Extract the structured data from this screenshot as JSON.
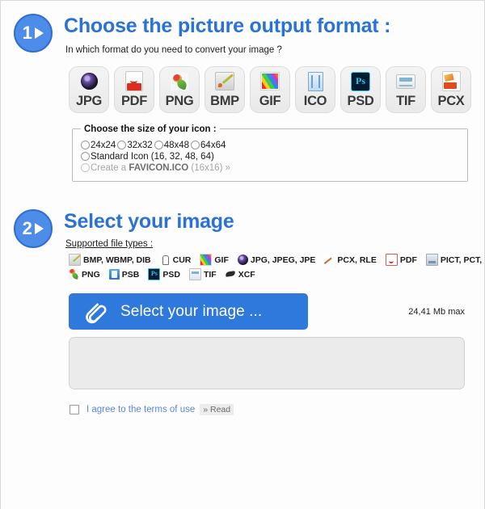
{
  "step1": {
    "badge_number": "1",
    "title": "Choose the picture output format :",
    "subtitle": "In which format do you need to convert your image ?",
    "formats": [
      {
        "label": "JPG",
        "icon": "jpg-camera-lens-icon"
      },
      {
        "label": "PDF",
        "icon": "pdf-document-icon"
      },
      {
        "label": "PNG",
        "icon": "png-image-icon"
      },
      {
        "label": "BMP",
        "icon": "bmp-paint-icon"
      },
      {
        "label": "GIF",
        "icon": "gif-rainbow-image-icon"
      },
      {
        "label": "ICO",
        "icon": "ico-icon"
      },
      {
        "label": "PSD",
        "icon": "psd-photoshop-icon"
      },
      {
        "label": "TIF",
        "icon": "tif-icon"
      },
      {
        "label": "PCX",
        "icon": "pcx-icon"
      }
    ],
    "size_fieldset": {
      "legend": "Choose the size of your icon :",
      "row1": [
        {
          "label": "24x24"
        },
        {
          "label": "32x32"
        },
        {
          "label": "48x48"
        },
        {
          "label": "64x64"
        }
      ],
      "row2_label": "Standard Icon (16, 32, 48, 64)",
      "row3_prefix": "Create a ",
      "row3_strong": "FAVICON.ICO",
      "row3_suffix": " (16x16) »"
    }
  },
  "step2": {
    "badge_number": "2",
    "title": "Select your image",
    "supported_label": "Supported file types :",
    "supported_line1": [
      {
        "label": "BMP, WBMP, DIB",
        "icon": "bmp-file-icon"
      },
      {
        "label": "CUR",
        "icon": "cur-cursor-icon"
      },
      {
        "label": "GIF",
        "icon": "gif-file-icon"
      },
      {
        "label": "JPG, JPEG, JPE",
        "icon": "jpg-file-icon"
      },
      {
        "label": "PCX, RLE",
        "icon": "pcx-file-icon"
      },
      {
        "label": "PDF",
        "icon": "pdf-file-icon"
      },
      {
        "label": "PICT, PCT, PIC",
        "icon": "pict-file-icon"
      }
    ],
    "supported_line2": [
      {
        "label": "PNG",
        "icon": "png-file-icon"
      },
      {
        "label": "PSB",
        "icon": "psb-file-icon"
      },
      {
        "label": "PSD",
        "icon": "psd-file-icon"
      },
      {
        "label": "TIF",
        "icon": "tif-file-icon"
      },
      {
        "label": "XCF",
        "icon": "xcf-file-icon"
      }
    ],
    "select_button_label": "Select your image ...",
    "select_button_icon": "paperclip-icon",
    "max_size": "24,41 Mb max"
  },
  "terms": {
    "agree_label": "I agree to the terms of use",
    "read_label": "» Read"
  },
  "colors": {
    "accent_blue": "#2a72d4",
    "badge_blue": "#4d8ce8",
    "button_blue": "#2f78dc",
    "link_blue": "#5b87d8",
    "page_bg": "#fdfdfd",
    "dropzone_bg": "#ebebeb"
  }
}
